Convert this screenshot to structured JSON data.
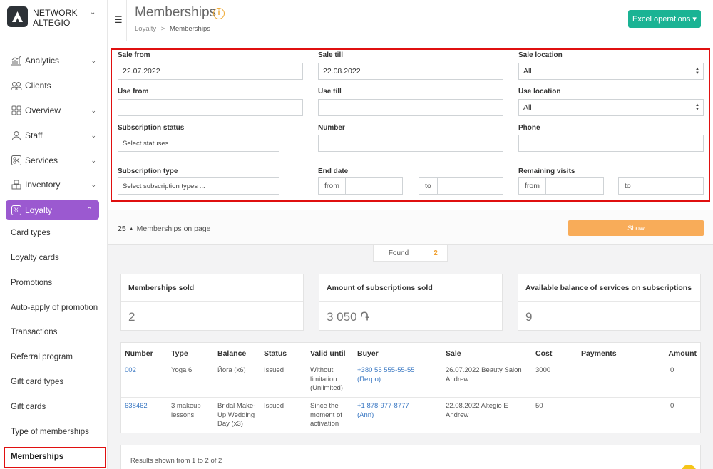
{
  "brand": {
    "line1": "NETWORK",
    "line2": "ALTEGIO"
  },
  "sidebar": {
    "items": [
      {
        "label": "Analytics",
        "icon": "chart-icon"
      },
      {
        "label": "Clients",
        "icon": "users-icon"
      },
      {
        "label": "Overview",
        "icon": "grid-icon"
      },
      {
        "label": "Staff",
        "icon": "person-icon"
      },
      {
        "label": "Services",
        "icon": "scissors-icon"
      },
      {
        "label": "Inventory",
        "icon": "boxes-icon"
      }
    ],
    "active": {
      "label": "Loyalty",
      "icon": "percent-icon"
    },
    "subitems": [
      "Card types",
      "Loyalty cards",
      "Promotions",
      "Auto-apply of promotion",
      "Transactions",
      "Referral program",
      "Gift card types",
      "Gift cards",
      "Type of memberships",
      "Memberships"
    ]
  },
  "header": {
    "title": "Memberships",
    "breadcrumb": {
      "parent": "Loyalty",
      "sep": ">",
      "current": "Memberships"
    },
    "excel_button": "Excel operations ▾"
  },
  "filters": {
    "sale_from": {
      "label": "Sale from",
      "value": "22.07.2022"
    },
    "sale_till": {
      "label": "Sale till",
      "value": "22.08.2022"
    },
    "sale_location": {
      "label": "Sale location",
      "value": "All"
    },
    "use_from": {
      "label": "Use from",
      "value": ""
    },
    "use_till": {
      "label": "Use till",
      "value": ""
    },
    "use_location": {
      "label": "Use location",
      "value": "All"
    },
    "subscription_status": {
      "label": "Subscription status",
      "placeholder": "Select statuses ..."
    },
    "number": {
      "label": "Number",
      "value": ""
    },
    "phone": {
      "label": "Phone",
      "value": ""
    },
    "subscription_type": {
      "label": "Subscription type",
      "placeholder": "Select subscription types ..."
    },
    "end_date": {
      "label": "End date",
      "from": "from",
      "to": "to"
    },
    "remaining_visits": {
      "label": "Remaining visits",
      "from": "from",
      "to": "to"
    }
  },
  "pagination": {
    "page_size": "25",
    "label": "Memberships on page"
  },
  "show_button": "Show",
  "found": {
    "label": "Found",
    "count": "2"
  },
  "stats": [
    {
      "title": "Memberships sold",
      "value": "2"
    },
    {
      "title": "Amount of subscriptions sold",
      "value": "3 050 ֏"
    },
    {
      "title": "Available balance of services on subscriptions",
      "value": "9"
    }
  ],
  "table": {
    "headers": [
      "Number",
      "Type",
      "Balance",
      "Status",
      "Valid until",
      "Buyer",
      "Sale",
      "Cost",
      "Payments",
      "Amount"
    ],
    "rows": [
      {
        "number": "002",
        "type": "Yoga 6",
        "balance": "Йога (x6)",
        "status": "Issued",
        "valid_until": "Without limitation (Unlimited)",
        "buyer": "+380 55 555-55-55 (Петро)",
        "sale": "26.07.2022 Beauty Salon Andrew",
        "cost": "3000",
        "payments": "",
        "amount": "0"
      },
      {
        "number": "638462",
        "type": "3 makeup lessons",
        "balance": "Bridal Make-Up Wedding Day (x3)",
        "status": "Issued",
        "valid_until": "Since the moment of activation",
        "buyer": "+1 878-977-8777 (Ann)",
        "sale": "22.08.2022 Altegio E Andrew",
        "cost": "50",
        "payments": "",
        "amount": "0"
      }
    ]
  },
  "results_text": "Results shown from 1 to 2 of 2",
  "colors": {
    "accent_purple": "#9b59d0",
    "teal": "#1ab394",
    "orange": "#f8ac59",
    "highlight_red": "#e01010"
  }
}
